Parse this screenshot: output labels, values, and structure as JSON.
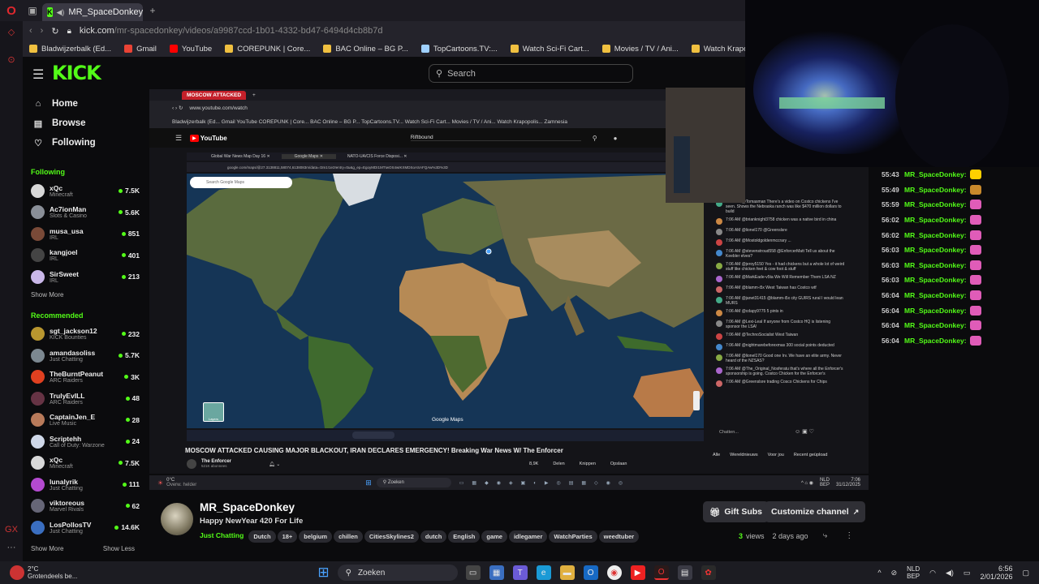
{
  "browser": {
    "tab_title": "MR_SpaceDonkey - W",
    "url_domain": "kick.com",
    "url_path": "/mr-spacedonkey/videos/a9987ccd-1b01-4332-bd47-6494d4cb8b7d",
    "bookmarks": [
      {
        "label": "Bladwijzerbalk (Ed...",
        "color": "#f0c040"
      },
      {
        "label": "Gmail",
        "color": "#ea4335"
      },
      {
        "label": "YouTube",
        "color": "#ff0000"
      },
      {
        "label": "COREPUNK | Core...",
        "color": "#f0c040"
      },
      {
        "label": "BAC Online – BG P...",
        "color": "#f0c040"
      },
      {
        "label": "TopCartoons.TV:...",
        "color": "#9fd0ff"
      },
      {
        "label": "Watch Sci-Fi Cart...",
        "color": "#f0c040"
      },
      {
        "label": "Movies / TV / Ani...",
        "color": "#f0c040"
      },
      {
        "label": "Watch Krapopolis...",
        "color": "#f0c040"
      },
      {
        "label": "Zamnesia |",
        "color": "#9ad"
      }
    ]
  },
  "header": {
    "logo": "KICK",
    "search_placeholder": "Search"
  },
  "sidebar": {
    "nav": [
      {
        "label": "Home",
        "icon": "home-icon",
        "glyph": "⌂"
      },
      {
        "label": "Browse",
        "icon": "browse-icon",
        "glyph": "▤"
      },
      {
        "label": "Following",
        "icon": "heart-icon",
        "glyph": "♡"
      }
    ],
    "following_title": "Following",
    "following": [
      {
        "name": "xQc",
        "category": "Minecraft",
        "viewers": "7.5K",
        "color": "#d8d8d8"
      },
      {
        "name": "Ac7ionMan",
        "category": "Slots & Casino",
        "viewers": "5.6K",
        "color": "#8a8f98"
      },
      {
        "name": "musa_usa",
        "category": "IRL",
        "viewers": "851",
        "color": "#7a4a38"
      },
      {
        "name": "kangjoel",
        "category": "IRL",
        "viewers": "401",
        "color": "#444"
      },
      {
        "name": "SirSweet",
        "category": "IRL",
        "viewers": "213",
        "color": "#c9b7e8"
      }
    ],
    "show_more": "Show More",
    "recommended_title": "Recommended",
    "recommended": [
      {
        "name": "sgt_jackson12",
        "category": "KICK Bounties",
        "viewers": "232",
        "color": "#b8962f"
      },
      {
        "name": "amandasoliss",
        "category": "Just Chatting",
        "viewers": "5.7K",
        "color": "#7c8891"
      },
      {
        "name": "TheBurntPeanut",
        "category": "ARC Raiders",
        "viewers": "3K",
        "color": "#e04020"
      },
      {
        "name": "TrulyEvILL",
        "category": "ARC Raiders",
        "viewers": "48",
        "color": "#634"
      },
      {
        "name": "CaptainJen_E",
        "category": "Live Music",
        "viewers": "28",
        "color": "#b87a5a"
      },
      {
        "name": "Scriptehh",
        "category": "Call of Duty: Warzone",
        "viewers": "24",
        "color": "#cfd8e8"
      },
      {
        "name": "xQc",
        "category": "Minecraft",
        "viewers": "7.5K",
        "color": "#d8d8d8"
      },
      {
        "name": "lunalyrik",
        "category": "Just Chatting",
        "viewers": "111",
        "color": "#b44ad0"
      },
      {
        "name": "viktoreous",
        "category": "Marvel Rivals",
        "viewers": "62",
        "color": "#667"
      },
      {
        "name": "LosPollosTV",
        "category": "Just Chatting",
        "viewers": "14.6K",
        "color": "#3a6ec0"
      }
    ],
    "show_more_2": "Show More",
    "show_less": "Show Less"
  },
  "stream": {
    "inner_tab": "MOSCOW ATTACKED",
    "inner_url": "www.youtube.com/watch",
    "inner_bookmarks": "Bladwijzerbalk (Ed...   Gmail   YouTube   COREPUNK | Core...   BAC Online – BG P...   TopCartoons.TV...   Watch Sci-Fi Cart...   Movies / TV / Ani...   Watch Krapopolis...   Zamnesia",
    "yt_search": "Riftbound",
    "maps_url": "google.com/maps/@27.3138811,58074,6138083m/data=!3m1!1e3!entry=ttu&g_ep=EgoyMDI1MTIwOS4wIKXMDSoASAFQAw%3D%3D",
    "maps_search": "Search Google Maps",
    "maps_label": "Google Maps",
    "maps_layers": "Layers",
    "video_title": "MOSCOW ATTACKED CAUSING MAJOR BLACKOUT, IRAN DECLARES EMERGENCY! Breaking War News W/ The Enforcer",
    "yt_channel": "The Enforcer",
    "yt_subs": "521K abonnees",
    "yt_actions": [
      "8,9K",
      "Delen",
      "Knippen",
      "Opslaan"
    ],
    "chat_placeholder": "Chatten...",
    "chat_filters": [
      "Alle",
      "Wereldnieuws",
      "Voor jou",
      "Recent geüpload"
    ],
    "chat_msgs": [
      "7:06 AM @Tomasman There's a video on Costco chickens I've seen. Shows the Nebraska ranch was like $470 million dollars to build",
      "7:06 AM @brianknight3758 chicken was a native bird in china",
      "7:06 AM @lionel170 @Greenslsre",
      "7:06 AM @Mostoldgoldenmccrary ...",
      "7:06 AM @stevenstroud558 @EnforcerMatt Tell us about the Keebler elves?",
      "7:06 AM @jeroy5150 Yes - it had chickens but a whole lot of weird stuff like chicken feet & cow foot & stuff",
      "7:06 AM @MarkEade-v5ta We Will Remember Them LSA NZ",
      "7:06 AM @blamm-i5x West Taiwan has Costco wtf",
      "7:06 AM @janet31415 @blamm-i5x city GUIRS rural I would lean MURS",
      "7:06 AM @cdapy9775 5 pints in",
      "7:06 AM @Lexi-Leal If anyone from Costco HQ is listening sponsor the LSA!",
      "7:06 AM @TechnoSocialist West Taiwan",
      "7:06 AM @nightmarebeforexmas 300 social points deducted",
      "7:06 AM @lionel170 Good one Irv. We have an elite army. Never heard of the NZSAS?",
      "7:06 AM @The_Original_Nosferatu that's where all the Enforcer's sponsorship is going. Costco Chicken for the Enforcer's",
      "7:06 AM @Greenslsre trading Cosco Chickens for Chips"
    ],
    "inner_search": "Zoeken",
    "inner_weather_temp": "0°C",
    "inner_weather_desc": "Overw. helder",
    "inner_lang": "NLD\nBEP",
    "inner_time": "7:06",
    "inner_date": "31/12/2025"
  },
  "right_chat": {
    "messages": [
      {
        "time": "55:43",
        "user": "MR_SpaceDonkey:",
        "emote": "#ffd000"
      },
      {
        "time": "55:49",
        "user": "MR_SpaceDonkey:",
        "emote": "#c98a2c"
      },
      {
        "time": "55:59",
        "user": "MR_SpaceDonkey:",
        "emote": "#e05cb8"
      },
      {
        "time": "56:02",
        "user": "MR_SpaceDonkey:",
        "emote": "#e05cb8"
      },
      {
        "time": "56:02",
        "user": "MR_SpaceDonkey:",
        "emote": "#e05cb8"
      },
      {
        "time": "56:03",
        "user": "MR_SpaceDonkey:",
        "emote": "#e05cb8"
      },
      {
        "time": "56:03",
        "user": "MR_SpaceDonkey:",
        "emote": "#e05cb8"
      },
      {
        "time": "56:03",
        "user": "MR_SpaceDonkey:",
        "emote": "#e05cb8"
      },
      {
        "time": "56:04",
        "user": "MR_SpaceDonkey:",
        "emote": "#e05cb8"
      },
      {
        "time": "56:04",
        "user": "MR_SpaceDonkey:",
        "emote": "#e05cb8"
      },
      {
        "time": "56:04",
        "user": "MR_SpaceDonkey:",
        "emote": "#e05cb8"
      },
      {
        "time": "56:04",
        "user": "MR_SpaceDonkey:",
        "emote": "#e05cb8"
      }
    ]
  },
  "channel": {
    "name": "MR_SpaceDonkey",
    "title": "Happy NewYear 420 For Life",
    "category": "Just Chatting",
    "tags": [
      "Dutch",
      "18+",
      "belgium",
      "chillen",
      "CitiesSkylines2",
      "dutch",
      "English",
      "game",
      "idlegamer",
      "WatchParties",
      "weedtuber"
    ],
    "gift_subs": "Gift Subs",
    "customize": "Customize channel",
    "views_count": "3",
    "views_label": "views",
    "ago": "2 days ago"
  },
  "taskbar": {
    "weather_temp": "2°C",
    "weather_desc": "Grotendeels be...",
    "search": "Zoeken",
    "lang1": "NLD",
    "lang2": "BEP",
    "time": "6:56",
    "date": "2/01/2026"
  },
  "colors": {
    "kick_green": "#53fc18",
    "bg": "#0b0b0d"
  }
}
